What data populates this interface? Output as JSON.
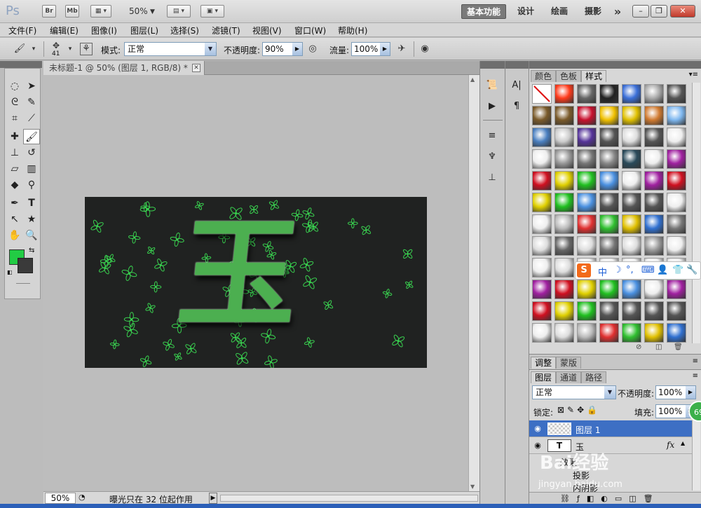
{
  "titlebar": {
    "logo": "Ps",
    "bridge": "Br",
    "minibridge": "Mb",
    "zoom": "50%",
    "workspaces": [
      "基本功能",
      "设计",
      "绘画",
      "摄影"
    ],
    "more": "»",
    "min": "–",
    "restore": "❐",
    "close": "✕"
  },
  "menu": [
    "文件(F)",
    "编辑(E)",
    "图像(I)",
    "图层(L)",
    "选择(S)",
    "滤镜(T)",
    "视图(V)",
    "窗口(W)",
    "帮助(H)"
  ],
  "options": {
    "brush_size": "41",
    "mode_label": "模式:",
    "mode_value": "正常",
    "opacity_label": "不透明度:",
    "opacity_value": "90%",
    "flow_label": "流量:",
    "flow_value": "100%"
  },
  "document": {
    "tab_title": "未标题-1 @ 50% (图层 1, RGB/8) *",
    "tab_close": "✕",
    "canvas_glyph": "玉",
    "glyph_color": "#4caf50",
    "sparkle_color": "#39d14f"
  },
  "status": {
    "zoom": "50%",
    "message": "曝光只在 32 位起作用",
    "arrow": "▶"
  },
  "colors": {
    "foreground": "#22cc44",
    "background": "#3a3a3a"
  },
  "styles_panel": {
    "tabs": [
      "颜色",
      "色板",
      "样式"
    ],
    "active_tab": "样式"
  },
  "adjust_panel": {
    "tabs": [
      "调整",
      "蒙版"
    ]
  },
  "layers_panel": {
    "tabs": [
      "图层",
      "通道",
      "路径"
    ],
    "blend_mode": "正常",
    "opacity_label": "不透明度:",
    "opacity_value": "100%",
    "lock_label": "锁定:",
    "fill_label": "填充:",
    "fill_value": "100%",
    "layers": [
      {
        "name": "图层 1",
        "thumb": "",
        "selected": true
      },
      {
        "name": "玉",
        "thumb": "T",
        "selected": false,
        "fx": "fx"
      }
    ],
    "effects_label": "效果",
    "effect_items": [
      "投影",
      "内阴影"
    ]
  },
  "ime": {
    "s": "S",
    "items": [
      "中",
      "☽",
      "°,",
      "⌨",
      "👤",
      "👕",
      "🔧"
    ]
  },
  "badge": "69",
  "watermark": {
    "line1": "Bai经验",
    "line2": "jingyan.baidu.com"
  }
}
